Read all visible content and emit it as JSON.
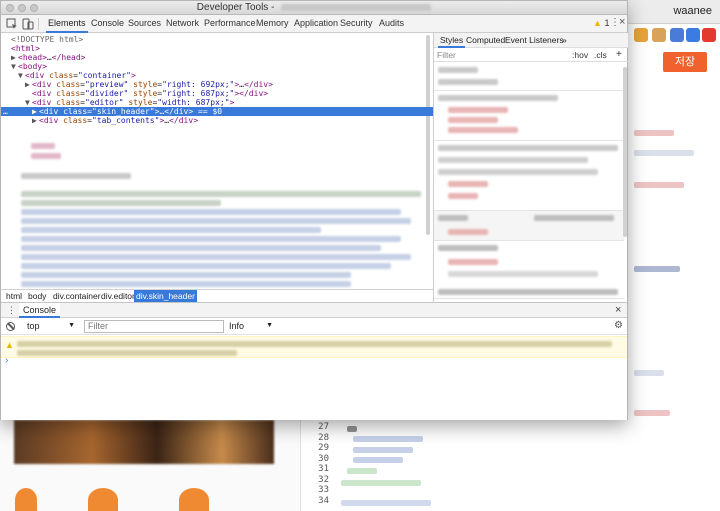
{
  "window": {
    "title": "Developer Tools - "
  },
  "browser": {
    "username": "waanee",
    "save_label": "저장"
  },
  "toolbar": {
    "tabs": [
      "Elements",
      "Console",
      "Sources",
      "Network",
      "Performance",
      "Memory",
      "Application",
      "Security",
      "Audits"
    ],
    "active_tab": "Elements",
    "warning_count": "1"
  },
  "elements": {
    "lines": [
      {
        "indent": 0,
        "html": "<!DOCTYPE html>"
      },
      {
        "indent": 0,
        "html": "<html>"
      },
      {
        "indent": 1,
        "html": "<head>…</head>"
      },
      {
        "indent": 1,
        "html": "<body>"
      },
      {
        "indent": 2,
        "html": "<div class=\"container\">"
      },
      {
        "indent": 3,
        "html": "<div class=\"preview\" style=\"right: 692px;\">…</div>"
      },
      {
        "indent": 3,
        "html": "<div class=\"divider\" style=\"right: 687px;\"></div>"
      },
      {
        "indent": 3,
        "html": "<div class=\"editor\" style=\"width: 687px;\">"
      },
      {
        "indent": 4,
        "html": "<div class=\"skin_header\">…</div> == $0",
        "selected": true
      },
      {
        "indent": 4,
        "html": "<div class=\"tab_contents\">…</div>"
      }
    ]
  },
  "breadcrumb": [
    "html",
    "body",
    "div.container",
    "div.editor",
    "div.skin_header"
  ],
  "styles": {
    "tabs": [
      "Styles",
      "Computed",
      "Event Listeners"
    ],
    "more": "»",
    "filter_placeholder": "Filter",
    "hov": ":hov",
    "cls": ".cls",
    "add": "+"
  },
  "console": {
    "tab_label": "Console",
    "context": "top",
    "filter_placeholder": "Filter",
    "level": "Info",
    "prompt": "›"
  },
  "code": {
    "line_numbers": [
      "27",
      "28",
      "29",
      "30",
      "31",
      "32",
      "33",
      "34"
    ]
  },
  "colors": {
    "accent": "#3879d9",
    "save_button": "#f0612e",
    "warning_bg": "#fffbe5"
  }
}
